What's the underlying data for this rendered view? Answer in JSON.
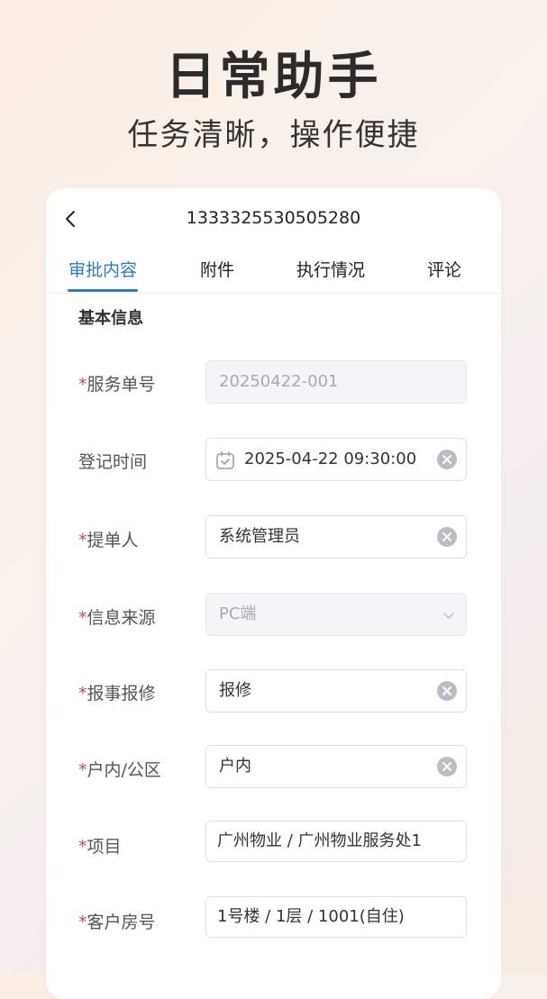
{
  "hero": {
    "title": "日常助手",
    "subtitle": "任务清晰，操作便捷"
  },
  "header": {
    "title": "1333325530505280",
    "back_icon": "chevron-left-icon"
  },
  "tabs": [
    {
      "label": "审批内容",
      "active": true
    },
    {
      "label": "附件",
      "active": false
    },
    {
      "label": "执行情况",
      "active": false
    },
    {
      "label": "评论",
      "active": false
    }
  ],
  "section": {
    "title": "基本信息"
  },
  "form": [
    {
      "label": "服务单号",
      "required": "*",
      "value": "20250422-001",
      "disabled": true
    },
    {
      "label": "登记时间",
      "required": "",
      "value": "2025-04-22 09:30:00",
      "icon": "calendar-icon",
      "clearable": true
    },
    {
      "label": "提单人",
      "required": "*",
      "value": "系统管理员",
      "clearable": true
    },
    {
      "label": "信息来源",
      "required": "*",
      "value": "PC端",
      "disabled": true,
      "dropdown": true
    },
    {
      "label": "报事报修",
      "required": "*",
      "value": "报修",
      "clearable": true
    },
    {
      "label": "户内/公区",
      "required": "*",
      "value": "户内",
      "clearable": true
    },
    {
      "label": "项目",
      "required": "*",
      "value": "广州物业 / 广州物业服务处1"
    },
    {
      "label": "客户房号",
      "required": "*",
      "value": "1号楼 / 1层 / 1001(自住)"
    }
  ],
  "colors": {
    "accent": "#2f78c4",
    "required": "#c0504d"
  }
}
